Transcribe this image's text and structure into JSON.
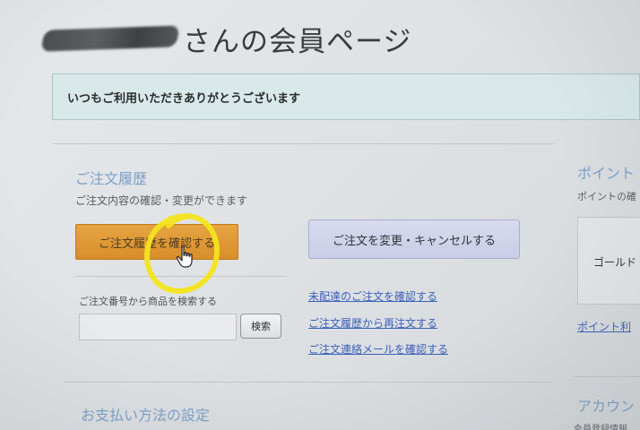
{
  "header": {
    "title_suffix": "さんの会員ページ"
  },
  "notice": {
    "text": "いつもご利用いただきありがとうございます"
  },
  "orders": {
    "title": "ご注文履歴",
    "description": "ご注文内容の確認・変更ができます",
    "view_history_button": "ご注文履歴を確認する",
    "change_cancel_button": "ご注文を変更・キャンセルする",
    "search_label": "ご注文番号から商品を検索する",
    "search_placeholder": "",
    "search_button": "検索",
    "links": [
      "未配達のご注文を確認する",
      "ご注文履歴から再注文する",
      "ご注文連絡メールを確認する"
    ]
  },
  "payment": {
    "title": "お支払い方法の設定"
  },
  "points": {
    "title": "ポイント",
    "description": "ポイントの確",
    "rank": "ゴールド",
    "link": "ポイント利"
  },
  "account": {
    "title": "アカウン",
    "subtitle": "会員登録情報"
  },
  "colors": {
    "primary_button": "#d88e2a",
    "secondary_button": "#c9cde6",
    "section_title": "#7aa0c8",
    "link": "#3b5fb8",
    "annotation": "#f4e41c",
    "notice_bg": "#d9e9ea"
  },
  "icons": {
    "cursor": "hand-pointer-icon",
    "annotation": "yellow-circle-annotation"
  }
}
